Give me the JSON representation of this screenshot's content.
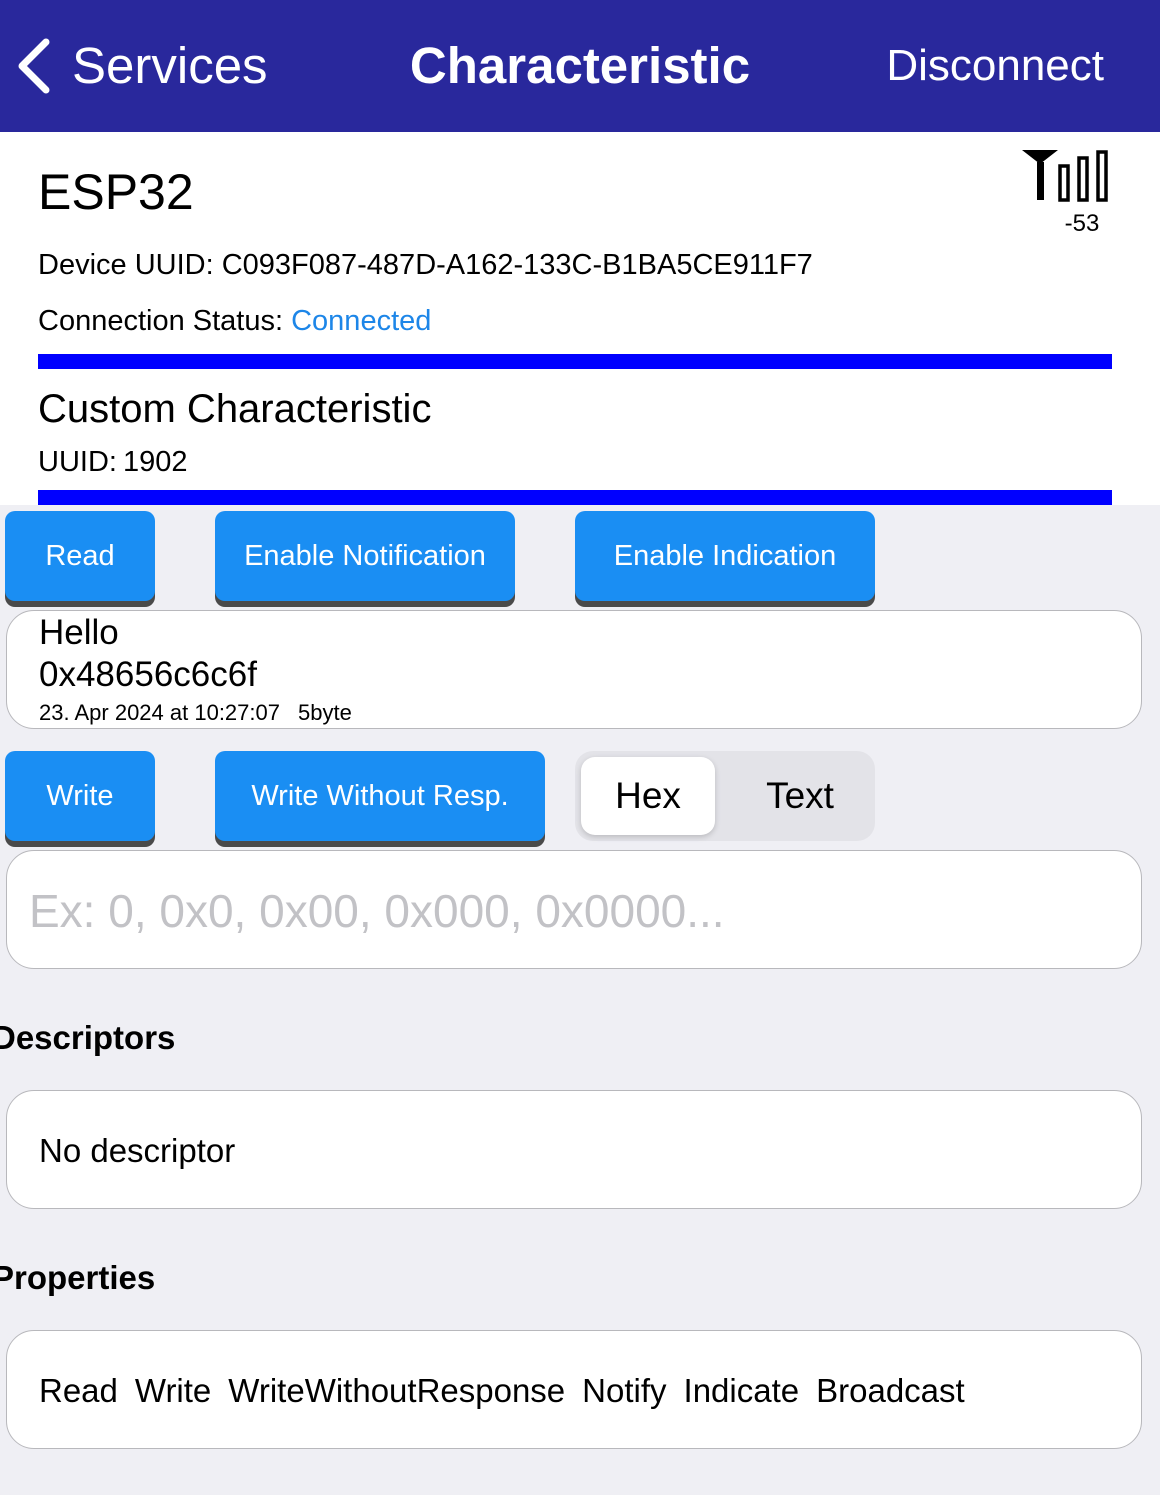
{
  "nav": {
    "back_label": "Services",
    "title": "Characteristic",
    "action_label": "Disconnect"
  },
  "device": {
    "name": "ESP32",
    "rssi": "-53",
    "uuid_label": "Device UUID:",
    "uuid": "C093F087-487D-A162-133C-B1BA5CE911F7",
    "status_label": "Connection Status:",
    "status": "Connected"
  },
  "characteristic": {
    "name": "Custom Characteristic",
    "uuid_label": "UUID:",
    "uuid": "1902"
  },
  "read_actions": {
    "read": "Read",
    "enable_notification": "Enable Notification",
    "enable_indication": "Enable Indication"
  },
  "value": {
    "text": "Hello",
    "hex": "0x48656c6c6f",
    "timestamp": "23. Apr 2024 at 10:27:07",
    "size": "5byte"
  },
  "write_actions": {
    "write": "Write",
    "write_without_response": "Write Without Resp."
  },
  "format_toggle": {
    "options": [
      "Hex",
      "Text"
    ],
    "selected": "Hex"
  },
  "write_input": {
    "value": "",
    "placeholder": "Ex: 0, 0x0, 0x00, 0x000, 0x0000..."
  },
  "descriptors": {
    "title": "Descriptors",
    "empty_text": "No descriptor"
  },
  "properties": {
    "title": "Properties",
    "items": [
      "Read",
      "Write",
      "WriteWithoutResponse",
      "Notify",
      "Indicate",
      "Broadcast"
    ]
  },
  "colors": {
    "nav_background": "#29289c",
    "button": "#1a8ef3",
    "divider": "#0000ff",
    "status_connected": "#1d86e8",
    "page_background": "#efeff4"
  },
  "icons": {
    "back": "chevron-left-icon",
    "signal": "signal-strength-icon"
  }
}
